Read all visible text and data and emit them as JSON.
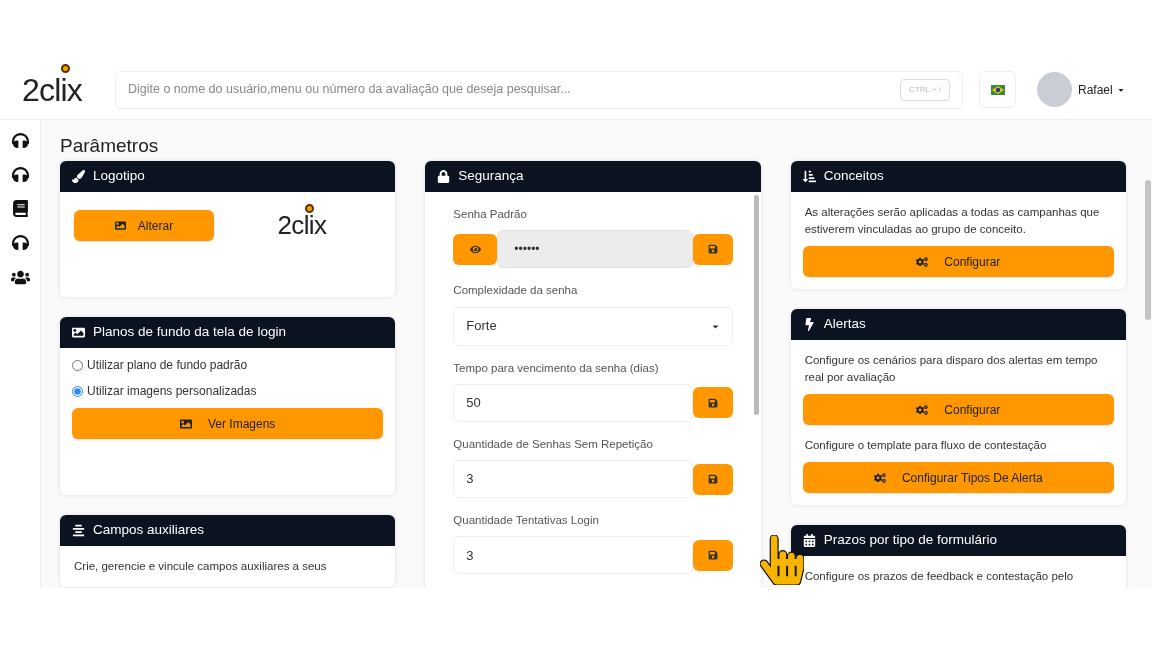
{
  "header": {
    "logo": "2clix",
    "search": {
      "placeholder": "Digite o nome do usuário,menu ou número da avaliação que deseja pesquisar...",
      "shortcut": "CTRL + /"
    },
    "user": {
      "name": "Rafael"
    }
  },
  "page_title": "Parâmetros",
  "columns": [
    [
      {
        "title": "Logotipo",
        "kind": "brush",
        "blocks": [
          {
            "kind": "logo_row",
            "button": "Alterar",
            "logo": "2clix"
          }
        ]
      },
      {
        "title": "Planos de fundo da tela de login",
        "kind": "image",
        "blocks": [
          {
            "kind": "radio",
            "label": "Utilizar plano de fundo padrão",
            "selected": false
          },
          {
            "kind": "radio",
            "label": "Utilizar imagens personalizadas",
            "selected": true
          },
          {
            "kind": "image_button",
            "label": "Ver Imagens"
          }
        ]
      },
      {
        "title": "Campos auxiliares",
        "kind": "lines",
        "blocks": [
          {
            "kind": "text",
            "text": "Crie, gerencie e vincule campos auxiliares a seus"
          }
        ]
      }
    ],
    [
      {
        "title": "Segurança",
        "kind": "lock",
        "blocks": [
          {
            "kind": "password",
            "label": "Senha Padrão",
            "value": "••••••"
          },
          {
            "kind": "select",
            "label": "Complexidade da senha",
            "value": "Forte"
          },
          {
            "kind": "field",
            "label": "Tempo para vencimento da senha (dias)",
            "value": "50"
          },
          {
            "kind": "field",
            "label": "Quantidade de Senhas Sem Repetição",
            "value": "3"
          },
          {
            "kind": "field",
            "label": "Quantidade Tentativas Login",
            "value": "3"
          }
        ]
      }
    ],
    [
      {
        "title": "Conceitos",
        "kind": "sort",
        "blocks": [
          {
            "kind": "text",
            "text": "As alterações serão aplicadas a todas as campanhas que estiverem vinculadas ao grupo de conceito."
          },
          {
            "kind": "gear_button",
            "label": "Configurar"
          }
        ]
      },
      {
        "title": "Alertas",
        "kind": "bolt",
        "blocks": [
          {
            "kind": "text",
            "text": "Configure os cenários para disparo dos alertas em tempo real por avaliação"
          },
          {
            "kind": "gear_button",
            "label": "Configurar"
          },
          {
            "kind": "text",
            "text": "Configure o template para fluxo de contestação"
          },
          {
            "kind": "gear_button",
            "label": "Configurar Tipos De Alerta"
          }
        ]
      },
      {
        "title": "Prazos por tipo de formulário",
        "kind": "calendar",
        "blocks": [
          {
            "kind": "text",
            "text": "Configure os prazos de feedback e contestação pelo"
          }
        ]
      }
    ]
  ]
}
